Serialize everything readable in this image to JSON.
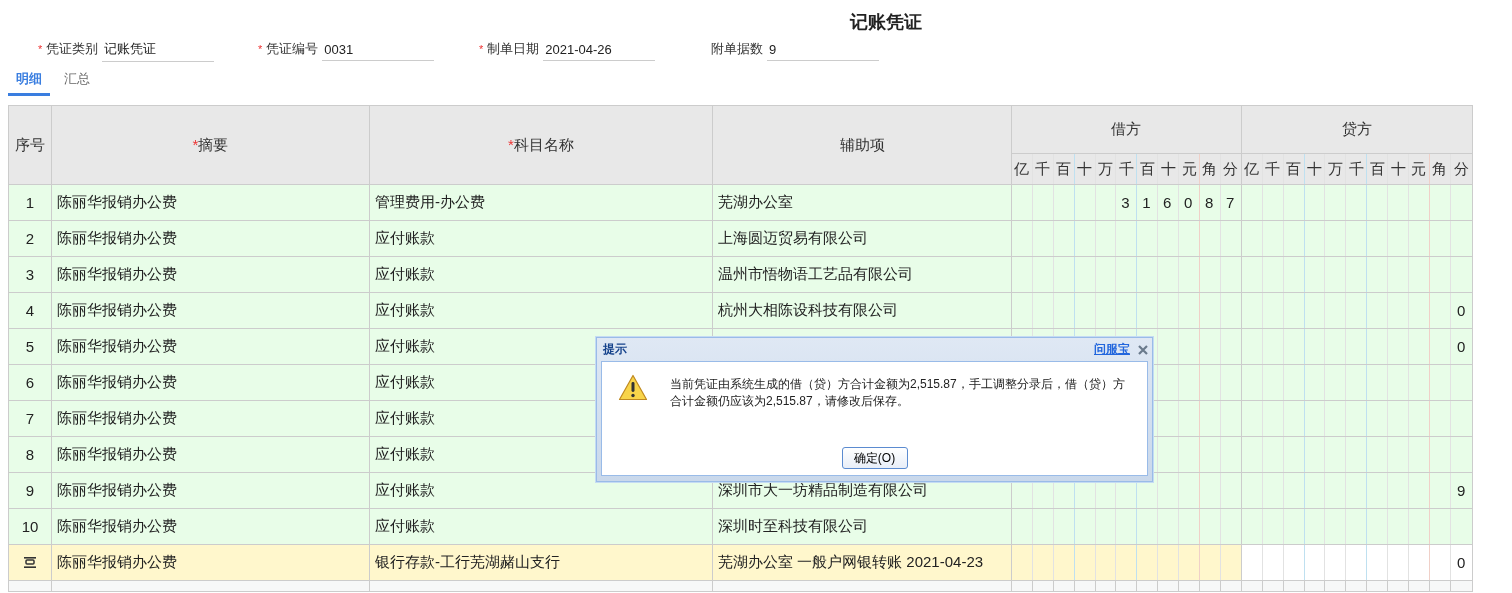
{
  "title": "记账凭证",
  "fields": [
    {
      "mark": "*",
      "label": "凭证类别",
      "value": "记账凭证"
    },
    {
      "mark": "*",
      "label": "凭证编号",
      "value": "0031"
    },
    {
      "mark": "*",
      "label": "制单日期",
      "value": "2021-04-26"
    },
    {
      "label": "附单据数",
      "value": "9"
    }
  ],
  "tabs": [
    {
      "label": "明细",
      "selected": true
    },
    {
      "label": "汇总",
      "selected": false
    }
  ],
  "table": {
    "columns": [
      {
        "label": "序号"
      },
      {
        "mark": "*",
        "label": "摘要"
      },
      {
        "mark": "*",
        "label": "科目名称"
      },
      {
        "label": "辅助项"
      }
    ],
    "debit_header": "借方",
    "credit_header": "贷方",
    "units": [
      "亿",
      "千",
      "百",
      "十",
      "万",
      "千",
      "百",
      "十",
      "元",
      "角",
      "分"
    ],
    "credit_units": [
      "亿",
      "千",
      "百",
      "十",
      "万",
      "千",
      "百",
      "十",
      "元",
      "角",
      "分"
    ],
    "rows": [
      {
        "kind": "entry",
        "index": "1",
        "summary": "陈丽华报销办公费",
        "account": "管理费用-办公费",
        "aux": "芜湖办公室",
        "debit": "316087"
      },
      {
        "kind": "entry",
        "index": "2",
        "summary": "陈丽华报销办公费",
        "account": "应付账款",
        "aux": "上海圆迈贸易有限公司"
      },
      {
        "kind": "entry",
        "index": "3",
        "summary": "陈丽华报销办公费",
        "account": "应付账款",
        "aux": "温州市悟物语工艺品有限公司"
      },
      {
        "kind": "entry",
        "index": "4",
        "summary": "陈丽华报销办公费",
        "account": "应付账款",
        "aux": "杭州大相陈设科技有限公司",
        "credit": "0"
      },
      {
        "kind": "entry",
        "index": "5",
        "summary": "陈丽华报销办公费",
        "account": "应付账款",
        "credit": "0"
      },
      {
        "kind": "entry",
        "index": "6",
        "summary": "陈丽华报销办公费",
        "account": "应付账款"
      },
      {
        "kind": "entry",
        "index": "7",
        "summary": "陈丽华报销办公费",
        "account": "应付账款"
      },
      {
        "kind": "entry",
        "index": "8",
        "summary": "陈丽华报销办公费",
        "account": "应付账款"
      },
      {
        "kind": "entry",
        "index": "9",
        "summary": "陈丽华报销办公费",
        "account": "应付账款",
        "aux": "深圳市大一坊精品制造有限公司",
        "credit": "9"
      },
      {
        "kind": "entry",
        "index": "10",
        "summary": "陈丽华报销办公费",
        "account": "应付账款",
        "aux": "深圳时至科技有限公司"
      },
      {
        "kind": "balance",
        "summary": "陈丽华报销办公费",
        "account": "银行存款-工行芜湖赭山支行",
        "aux": "芜湖办公室 一般户网银转账 2021-04-23",
        "credit": "0"
      }
    ]
  },
  "dialog": {
    "title": "提示",
    "link": "问服宝",
    "message": "当前凭证由系统生成的借（贷）方合计金额为2,515.87，手工调整分录后，借（贷）方合计金额仍应该为2,515.87，请修改后保存。",
    "button": "确定(O)"
  }
}
